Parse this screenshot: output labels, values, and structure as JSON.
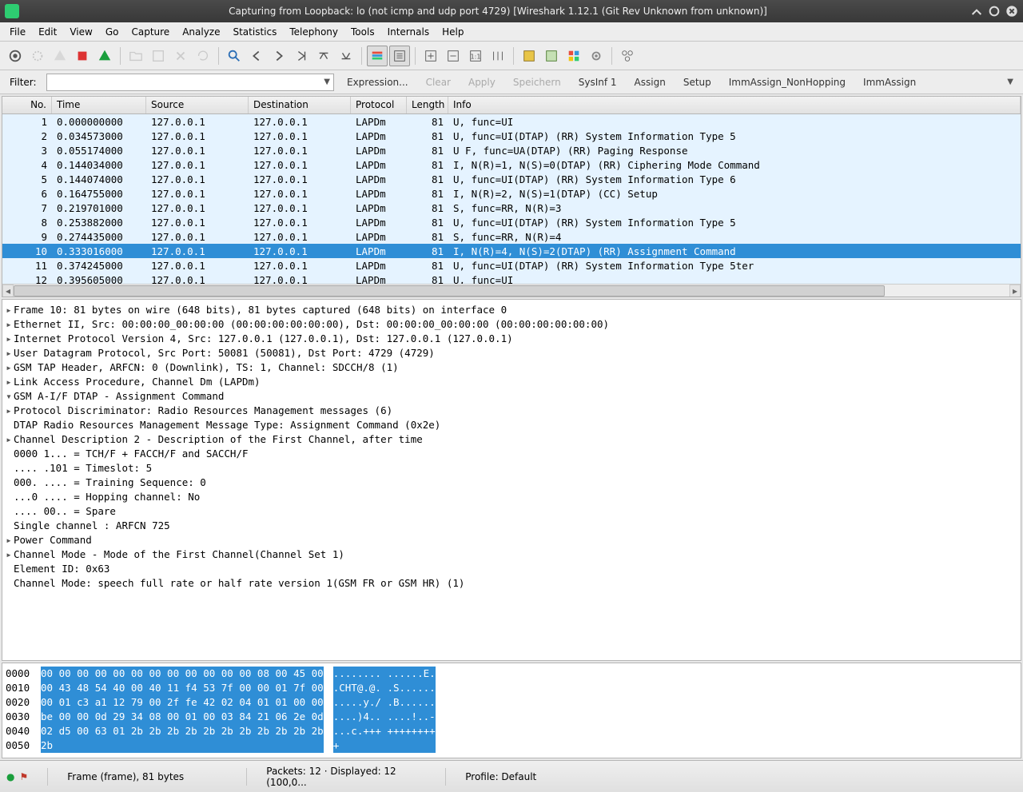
{
  "window": {
    "title": "Capturing from Loopback: lo (not icmp and udp port 4729)      [Wireshark 1.12.1  (Git Rev Unknown from unknown)]"
  },
  "menus": [
    "File",
    "Edit",
    "View",
    "Go",
    "Capture",
    "Analyze",
    "Statistics",
    "Telephony",
    "Tools",
    "Internals",
    "Help"
  ],
  "filter": {
    "label": "Filter:",
    "value": "",
    "expression": "Expression...",
    "clear": "Clear",
    "apply": "Apply",
    "save": "Speichern",
    "btn1": "SysInf 1",
    "btn2": "Assign",
    "btn3": "Setup",
    "btn4": "ImmAssign_NonHopping",
    "btn5": "ImmAssign"
  },
  "columns": {
    "no": "No.",
    "time": "Time",
    "src": "Source",
    "dst": "Destination",
    "proto": "Protocol",
    "len": "Length",
    "info": "Info"
  },
  "packets": [
    {
      "no": "1",
      "time": "0.000000000",
      "src": "127.0.0.1",
      "dst": "127.0.0.1",
      "proto": "LAPDm",
      "len": "81",
      "info": "U, func=UI"
    },
    {
      "no": "2",
      "time": "0.034573000",
      "src": "127.0.0.1",
      "dst": "127.0.0.1",
      "proto": "LAPDm",
      "len": "81",
      "info": "U, func=UI(DTAP) (RR) System Information Type 5"
    },
    {
      "no": "3",
      "time": "0.055174000",
      "src": "127.0.0.1",
      "dst": "127.0.0.1",
      "proto": "LAPDm",
      "len": "81",
      "info": "U F, func=UA(DTAP) (RR) Paging Response"
    },
    {
      "no": "4",
      "time": "0.144034000",
      "src": "127.0.0.1",
      "dst": "127.0.0.1",
      "proto": "LAPDm",
      "len": "81",
      "info": "I, N(R)=1, N(S)=0(DTAP) (RR) Ciphering Mode Command"
    },
    {
      "no": "5",
      "time": "0.144074000",
      "src": "127.0.0.1",
      "dst": "127.0.0.1",
      "proto": "LAPDm",
      "len": "81",
      "info": "U, func=UI(DTAP) (RR) System Information Type 6"
    },
    {
      "no": "6",
      "time": "0.164755000",
      "src": "127.0.0.1",
      "dst": "127.0.0.1",
      "proto": "LAPDm",
      "len": "81",
      "info": "I, N(R)=2, N(S)=1(DTAP) (CC) Setup"
    },
    {
      "no": "7",
      "time": "0.219701000",
      "src": "127.0.0.1",
      "dst": "127.0.0.1",
      "proto": "LAPDm",
      "len": "81",
      "info": "S, func=RR, N(R)=3"
    },
    {
      "no": "8",
      "time": "0.253882000",
      "src": "127.0.0.1",
      "dst": "127.0.0.1",
      "proto": "LAPDm",
      "len": "81",
      "info": "U, func=UI(DTAP) (RR) System Information Type 5"
    },
    {
      "no": "9",
      "time": "0.274435000",
      "src": "127.0.0.1",
      "dst": "127.0.0.1",
      "proto": "LAPDm",
      "len": "81",
      "info": "S, func=RR, N(R)=4"
    },
    {
      "no": "10",
      "time": "0.333016000",
      "src": "127.0.0.1",
      "dst": "127.0.0.1",
      "proto": "LAPDm",
      "len": "81",
      "info": "I, N(R)=4, N(S)=2(DTAP) (RR) Assignment Command",
      "selected": true
    },
    {
      "no": "11",
      "time": "0.374245000",
      "src": "127.0.0.1",
      "dst": "127.0.0.1",
      "proto": "LAPDm",
      "len": "81",
      "info": "U, func=UI(DTAP) (RR) System Information Type 5ter"
    },
    {
      "no": "12",
      "time": "0.395605000",
      "src": "127.0.0.1",
      "dst": "127.0.0.1",
      "proto": "LAPDm",
      "len": "81",
      "info": "U, func=UI"
    }
  ],
  "details": [
    {
      "indent": 0,
      "exp": ">",
      "text": "Frame 10: 81 bytes on wire (648 bits), 81 bytes captured (648 bits) on interface 0"
    },
    {
      "indent": 0,
      "exp": ">",
      "text": "Ethernet II, Src: 00:00:00_00:00:00 (00:00:00:00:00:00), Dst: 00:00:00_00:00:00 (00:00:00:00:00:00)"
    },
    {
      "indent": 0,
      "exp": ">",
      "text": "Internet Protocol Version 4, Src: 127.0.0.1 (127.0.0.1), Dst: 127.0.0.1 (127.0.0.1)"
    },
    {
      "indent": 0,
      "exp": ">",
      "text": "User Datagram Protocol, Src Port: 50081 (50081), Dst Port: 4729 (4729)"
    },
    {
      "indent": 0,
      "exp": ">",
      "text": "GSM TAP Header, ARFCN: 0 (Downlink), TS: 1, Channel: SDCCH/8 (1)"
    },
    {
      "indent": 0,
      "exp": ">",
      "text": "Link Access Procedure, Channel Dm (LAPDm)"
    },
    {
      "indent": 0,
      "exp": "v",
      "text": "GSM A-I/F DTAP - Assignment Command"
    },
    {
      "indent": 1,
      "exp": ">",
      "text": "Protocol Discriminator: Radio Resources Management messages (6)"
    },
    {
      "indent": 1,
      "exp": " ",
      "text": "DTAP Radio Resources Management Message Type: Assignment Command (0x2e)"
    },
    {
      "indent": 1,
      "exp": ">",
      "text": "Channel Description 2 - Description of the First Channel, after time"
    },
    {
      "indent": 2,
      "exp": " ",
      "text": "0000 1... = TCH/F + FACCH/F and SACCH/F"
    },
    {
      "indent": 2,
      "exp": " ",
      "text": ".... .101 = Timeslot: 5"
    },
    {
      "indent": 2,
      "exp": " ",
      "text": "000. .... = Training Sequence: 0"
    },
    {
      "indent": 2,
      "exp": " ",
      "text": "...0 .... = Hopping channel: No"
    },
    {
      "indent": 2,
      "exp": " ",
      "text": ".... 00.. = Spare"
    },
    {
      "indent": 2,
      "exp": " ",
      "text": "Single channel : ARFCN 725"
    },
    {
      "indent": 1,
      "exp": ">",
      "text": "Power Command"
    },
    {
      "indent": 1,
      "exp": ">",
      "text": "Channel Mode - Mode of the First Channel(Channel Set 1)"
    },
    {
      "indent": 2,
      "exp": " ",
      "text": "Element ID: 0x63"
    },
    {
      "indent": 2,
      "exp": " ",
      "text": "Channel Mode: speech full rate or half rate version 1(GSM FR or GSM HR) (1)"
    }
  ],
  "hex": {
    "offsets": [
      "0000",
      "0010",
      "0020",
      "0030",
      "0040",
      "0050"
    ],
    "bytes": [
      "00 00 00 00 00 00 00 00  00 00 00 00 08 00 45 00",
      "00 43 48 54 40 00 40 11  f4 53 7f 00 00 01 7f 00",
      "00 01 c3 a1 12 79 00 2f  fe 42 02 04 01 01 00 00",
      "be 00 00 0d 29 34 08 00  01 00 03 84 21 06 2e 0d",
      "02 d5 00 63 01 2b 2b 2b  2b 2b 2b 2b 2b 2b 2b 2b",
      "2b"
    ],
    "ascii": [
      "........ ......E.",
      ".CHT@.@. .S......",
      ".....y./ .B......",
      "....)4.. ....!..-",
      "...c.+++ ++++++++",
      "+"
    ]
  },
  "status": {
    "frame": "Frame (frame), 81 bytes",
    "packets": "Packets: 12 · Displayed: 12 (100,0...",
    "profile": "Profile: Default"
  }
}
